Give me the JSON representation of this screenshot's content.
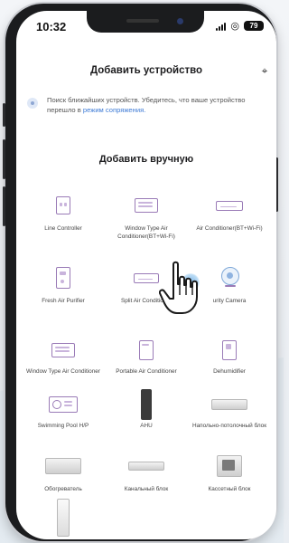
{
  "status_bar": {
    "time": "10:32",
    "battery": "79"
  },
  "header": {
    "title": "Добавить устройство"
  },
  "info": {
    "text": "Поиск ближайших устройств. Убедитесь, что ваше устройство перешло в ",
    "link": "режим сопряжения."
  },
  "section": {
    "title": "Добавить вручную"
  },
  "devices": [
    {
      "label": "Line Controller",
      "icon": "line-controller-icon"
    },
    {
      "label": "Window Type Air Conditioner(BT+Wi-Fi)",
      "icon": "window-ac-icon"
    },
    {
      "label": "Air Conditioner(BT+Wi-Fi)",
      "icon": "split-ac-icon"
    },
    {
      "label": "Fresh Air Purifier",
      "icon": "air-purifier-icon"
    },
    {
      "label": "Split Air Conditioner",
      "icon": "split-ac-icon"
    },
    {
      "label": "urity Camera",
      "icon": "camera-icon"
    },
    {
      "label": "Window Type Air Conditioner",
      "icon": "window-ac-icon"
    },
    {
      "label": "Portable Air Conditioner",
      "icon": "portable-ac-icon"
    },
    {
      "label": "Dehumidifier",
      "icon": "dehumidifier-icon"
    },
    {
      "label": "Swimming Pool H/P",
      "icon": "pool-heat-pump-icon"
    },
    {
      "label": "AHU",
      "icon": "ahu-icon"
    },
    {
      "label": "Напольно-потолочный блок",
      "icon": "floor-ceiling-unit-icon"
    },
    {
      "label": "Обогреватель",
      "icon": "heater-icon"
    },
    {
      "label": "Канальный блок",
      "icon": "duct-unit-icon"
    },
    {
      "label": "Кассетный блок",
      "icon": "cassette-unit-icon"
    },
    {
      "label": "",
      "icon": "column-unit-icon"
    }
  ],
  "colors": {
    "accent_purple": "#9a7bb7",
    "link_blue": "#3e7bd6"
  }
}
